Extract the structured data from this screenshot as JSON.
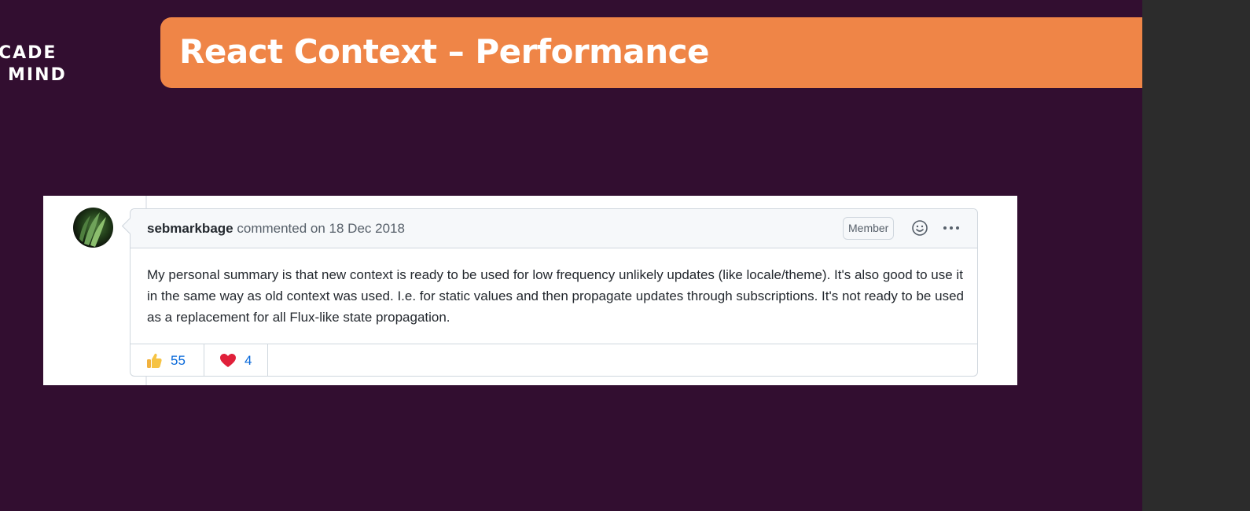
{
  "logo": {
    "line1": "CADE",
    "line2": "MIND"
  },
  "slide": {
    "title": "React Context – Performance"
  },
  "comment": {
    "author": "sebmarkbage",
    "action": "commented on",
    "date": "18 Dec 2018",
    "badge": "Member",
    "body": "My personal summary is that new context is ready to be used for low frequency unlikely updates (like locale/theme). It's also good to use it in the same way as old context was used. I.e. for static values and then propagate updates through subscriptions. It's not ready to be used as a replacement for all Flux-like state propagation.",
    "reactions": [
      {
        "icon": "thumbs-up-icon",
        "count": "55"
      },
      {
        "icon": "heart-icon",
        "count": "4"
      }
    ]
  },
  "colors": {
    "background": "#320e30",
    "title_banner": "#ef8547",
    "link_blue": "#0969da"
  }
}
